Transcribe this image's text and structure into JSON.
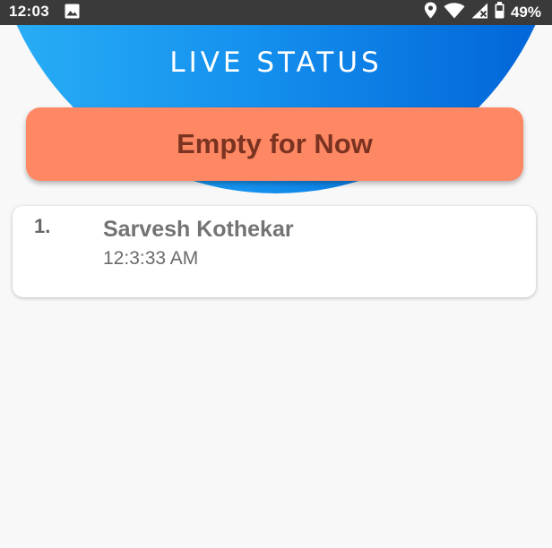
{
  "status_bar": {
    "time": "12:03",
    "battery": "49%",
    "icons": [
      "image-icon",
      "location-icon",
      "wifi-icon",
      "signal-icon",
      "battery-icon"
    ]
  },
  "header": {
    "title": "LIVE STATUS",
    "gradient_colors": [
      "#2ab0f6",
      "#0062d6"
    ]
  },
  "banner": {
    "text": "Empty for Now",
    "color": "#ff8864"
  },
  "list": {
    "items": [
      {
        "index": "1.",
        "name": "Sarvesh Kothekar",
        "time": "12:3:33 AM"
      }
    ]
  }
}
